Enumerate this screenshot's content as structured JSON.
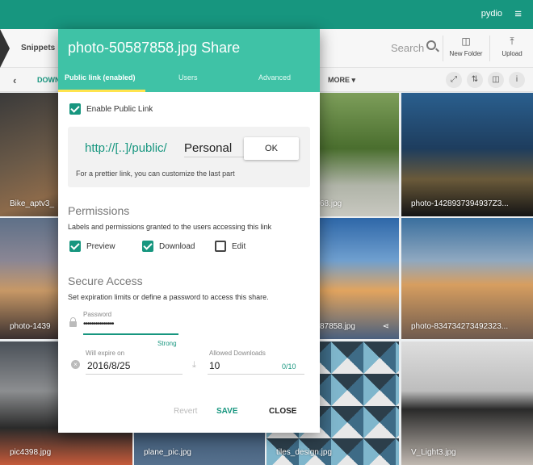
{
  "topbar": {
    "user": "pydio",
    "menu_icon": "hamburger-icon"
  },
  "toolbar": {
    "breadcrumb": "Snippets",
    "search_placeholder": "Search",
    "new_folder": "New Folder",
    "upload": "Upload"
  },
  "subbar": {
    "tab": "DOWN",
    "more": "MORE ▾"
  },
  "tiles": [
    {
      "caption": "Bike_aptv3_",
      "share": ""
    },
    {
      "caption": "",
      "share": ""
    },
    {
      "caption": "68.jpg",
      "share": ""
    },
    {
      "caption": "photo-1428937394937Z3...",
      "share": ""
    },
    {
      "caption": "photo-1439",
      "share": ""
    },
    {
      "caption": "",
      "share": ""
    },
    {
      "caption": "87858.jpg",
      "share": "•‹•"
    },
    {
      "caption": "photo-834734273492323...",
      "share": ""
    },
    {
      "caption": "pic4398.jpg",
      "share": ""
    },
    {
      "caption": "plane_pic.jpg",
      "share": ""
    },
    {
      "caption": "tiles_design.jpg",
      "share": ""
    },
    {
      "caption": "V_Light3.jpg",
      "share": ""
    }
  ],
  "dialog": {
    "title": "photo-50587858.jpg Share",
    "tabs": [
      "Public link (enabled)",
      "Users",
      "Advanced"
    ],
    "enable_public_link": "Enable Public Link",
    "link_prefix": "http://[..]/public/",
    "link_value": "Personal",
    "ok": "OK",
    "link_hint": "For a prettier link, you can customize the last part",
    "permissions_title": "Permissions",
    "permissions_desc": "Labels and permissions granted to the users accessing this link",
    "perm_preview": "Preview",
    "perm_download": "Download",
    "perm_edit": "Edit",
    "secure_title": "Secure Access",
    "secure_desc": "Set expiration limits or define a password to access this share.",
    "password_label": "Password",
    "password_value": "•••••••••••••••",
    "strength": "Strong",
    "expire_label": "Will expire on",
    "expire_value": "2016/8/25",
    "downloads_label": "Allowed Downloads",
    "downloads_value": "10",
    "downloads_counter": "0/10",
    "revert": "Revert",
    "save": "SAVE",
    "close": "CLOSE"
  },
  "colors": {
    "brand": "#17967f",
    "header": "#3fc2a6",
    "tab_indicator": "#ffe44d"
  }
}
